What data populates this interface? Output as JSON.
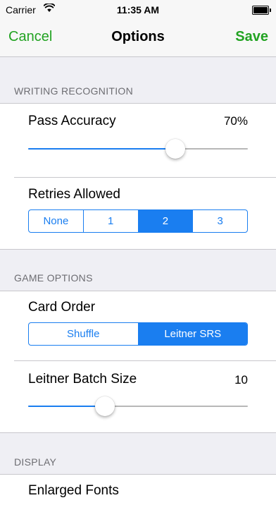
{
  "status_bar": {
    "carrier": "Carrier",
    "time": "11:35 AM"
  },
  "nav": {
    "cancel": "Cancel",
    "title": "Options",
    "save": "Save"
  },
  "writing_recognition": {
    "header": "WRITING RECOGNITION",
    "pass_accuracy": {
      "label": "Pass Accuracy",
      "value": "70%",
      "level": 0.67
    },
    "retries_allowed": {
      "label": "Retries Allowed",
      "options": [
        "None",
        "1",
        "2",
        "3"
      ],
      "selected_index": 2
    }
  },
  "game_options": {
    "header": "GAME OPTIONS",
    "card_order": {
      "label": "Card Order",
      "options": [
        "Shuffle",
        "Leitner SRS"
      ],
      "selected_index": 1
    },
    "leitner_batch_size": {
      "label": "Leitner Batch Size",
      "value": "10",
      "level": 0.35
    }
  },
  "display": {
    "header": "DISPLAY",
    "enlarged_fonts": {
      "label": "Enlarged Fonts"
    }
  },
  "colors": {
    "accent_green": "#22a322",
    "accent_blue": "#1a7ef0",
    "background": "#efeff4"
  },
  "icons": {
    "wifi": "wifi-icon",
    "battery": "battery-icon"
  }
}
